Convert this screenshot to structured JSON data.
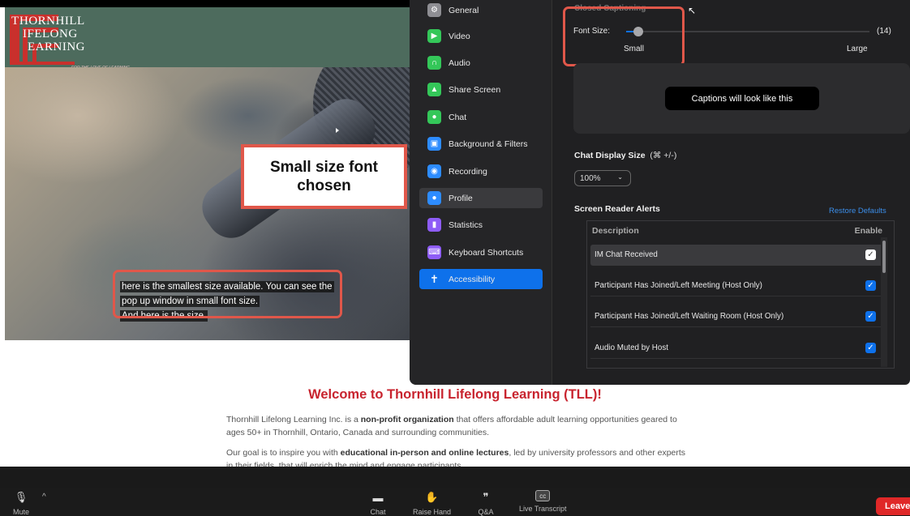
{
  "website": {
    "logo": {
      "line1": "HORNHILL",
      "line2": "IFELONG",
      "line3": "EARNING",
      "tagline": "FOR THE LOVE OF LEARNING"
    },
    "callout": "Small size font chosen",
    "captions": [
      "here is the smallest size available. You can see the",
      "pop up window in small font size.",
      "And here is the size."
    ],
    "welcome": "Welcome to Thornhill Lifelong Learning (TLL)!",
    "para1": {
      "pre": "Thornhill Lifelong Learning Inc. is a ",
      "bold": "non-profit organization",
      "post": " that offers affordable adult learning opportunities geared to",
      "line2": "ages 50+ in Thornhill, Ontario, Canada and surrounding communities."
    },
    "para2": {
      "pre": "Our goal is to inspire you with ",
      "bold": "educational in-person and online lectures",
      "post": ", led by university professors and other experts",
      "line2": "in their fields, that will enrich the mind and engage participants."
    }
  },
  "settings": {
    "sidebar": [
      {
        "label": "General",
        "icon": "gear-icon",
        "color": "#8e8e93"
      },
      {
        "label": "Video",
        "icon": "video-icon",
        "color": "#34c759"
      },
      {
        "label": "Audio",
        "icon": "headphones-icon",
        "color": "#34c759"
      },
      {
        "label": "Share Screen",
        "icon": "share-screen-icon",
        "color": "#34c759"
      },
      {
        "label": "Chat",
        "icon": "chat-icon",
        "color": "#34c759"
      },
      {
        "label": "Background & Filters",
        "icon": "background-icon",
        "color": "#2d8cff"
      },
      {
        "label": "Recording",
        "icon": "recording-icon",
        "color": "#2d8cff"
      },
      {
        "label": "Profile",
        "icon": "profile-icon",
        "color": "#2d8cff"
      },
      {
        "label": "Statistics",
        "icon": "statistics-icon",
        "color": "#8e5cf7"
      },
      {
        "label": "Keyboard Shortcuts",
        "icon": "keyboard-icon",
        "color": "#8e5cf7"
      },
      {
        "label": "Accessibility",
        "icon": "accessibility-icon",
        "color": "#0e71eb"
      }
    ],
    "closed_captioning": {
      "title": "Closed Captioning",
      "font_size_label": "Font Size:",
      "font_size_value": "(14)",
      "slider_level": 0.05,
      "min_label": "Small",
      "max_label": "Large",
      "preview": "Captions will look like this"
    },
    "chat_display": {
      "label": "Chat Display Size",
      "shortcut": "(⌘ +/-)",
      "value": "100%"
    },
    "screen_reader": {
      "label": "Screen Reader Alerts",
      "restore": "Restore Defaults",
      "col_description": "Description",
      "col_enable": "Enable",
      "rows": [
        {
          "name": "IM Chat Received",
          "enabled": true
        },
        {
          "name": "Participant Has Joined/Left Meeting (Host Only)",
          "enabled": true
        },
        {
          "name": "Participant Has Joined/Left Waiting Room (Host Only)",
          "enabled": true
        },
        {
          "name": "Audio Muted by Host",
          "enabled": true
        }
      ]
    }
  },
  "toolbar": {
    "mute": "Mute",
    "chat": "Chat",
    "raise_hand": "Raise Hand",
    "qa": "Q&A",
    "live_transcript": "Live Transcript",
    "leave": "Leave"
  }
}
